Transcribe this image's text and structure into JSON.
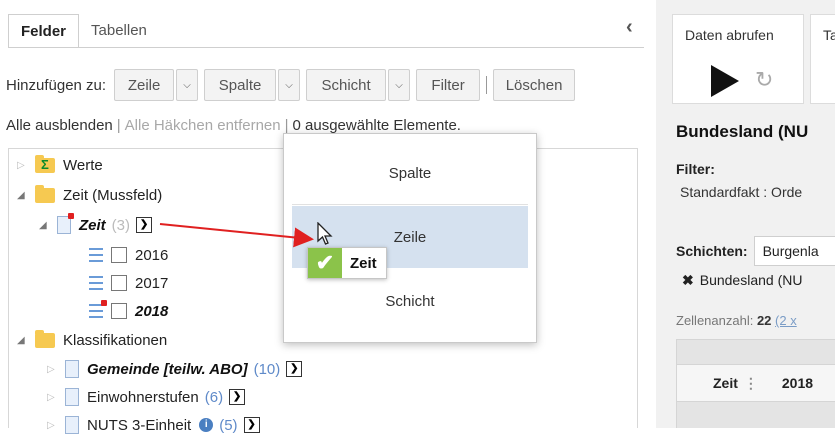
{
  "tabs": [
    {
      "label": "Felder"
    },
    {
      "label": "Tabellen"
    }
  ],
  "collapse_icon": "chevron-left-icon",
  "toolbar": {
    "add_to_label": "Hinzufügen zu:",
    "row_label": "Zeile",
    "column_label": "Spalte",
    "layer_label": "Schicht",
    "filter_label": "Filter",
    "separator": "|",
    "delete_label": "Löschen"
  },
  "actions": {
    "hide_all": "Alle ausblenden",
    "remove_checks": "Alle Häkchen entfernen",
    "selected": "0 ausgewählte Elemente."
  },
  "tree": {
    "werte": "Werte",
    "zeit_folder": "Zeit (Mussfeld)",
    "zeit": {
      "label": "Zeit",
      "count": "(3)"
    },
    "years": [
      "2016",
      "2017",
      "2018"
    ],
    "klassifikationen": "Klassifikationen",
    "gemeinde": {
      "label": "Gemeinde [teilw. ABO]",
      "count": "(10)"
    },
    "einwohnerstufen": {
      "label": "Einwohnerstufen",
      "count": "(6)"
    },
    "nuts3": {
      "label": "NUTS 3-Einheit",
      "count": "(5)"
    }
  },
  "popup": {
    "options": [
      "Spalte",
      "Zeile",
      "Schicht"
    ],
    "dragged_item": "Zeit"
  },
  "right": {
    "fetch_label": "Daten abrufen",
    "next_label_partial": "Ta",
    "title": "Bundesland (NU",
    "filter_label": "Filter:",
    "filter_value": "Standardfakt : Orde",
    "layers_label": "Schichten:",
    "layers_value": "Burgenla",
    "tag": "Bundesland (NU",
    "cell_count_label": "Zellenanzahl:",
    "cell_count_value": "22",
    "cell_count_link": "(2 x",
    "table_header_zeit": "Zeit",
    "table_header_year": "2018"
  },
  "colors": {
    "highlight": "#d5e1ef",
    "check_green": "#8bc34a",
    "drag_arrow": "#e02020",
    "count_blue": "#5f8ac9"
  }
}
